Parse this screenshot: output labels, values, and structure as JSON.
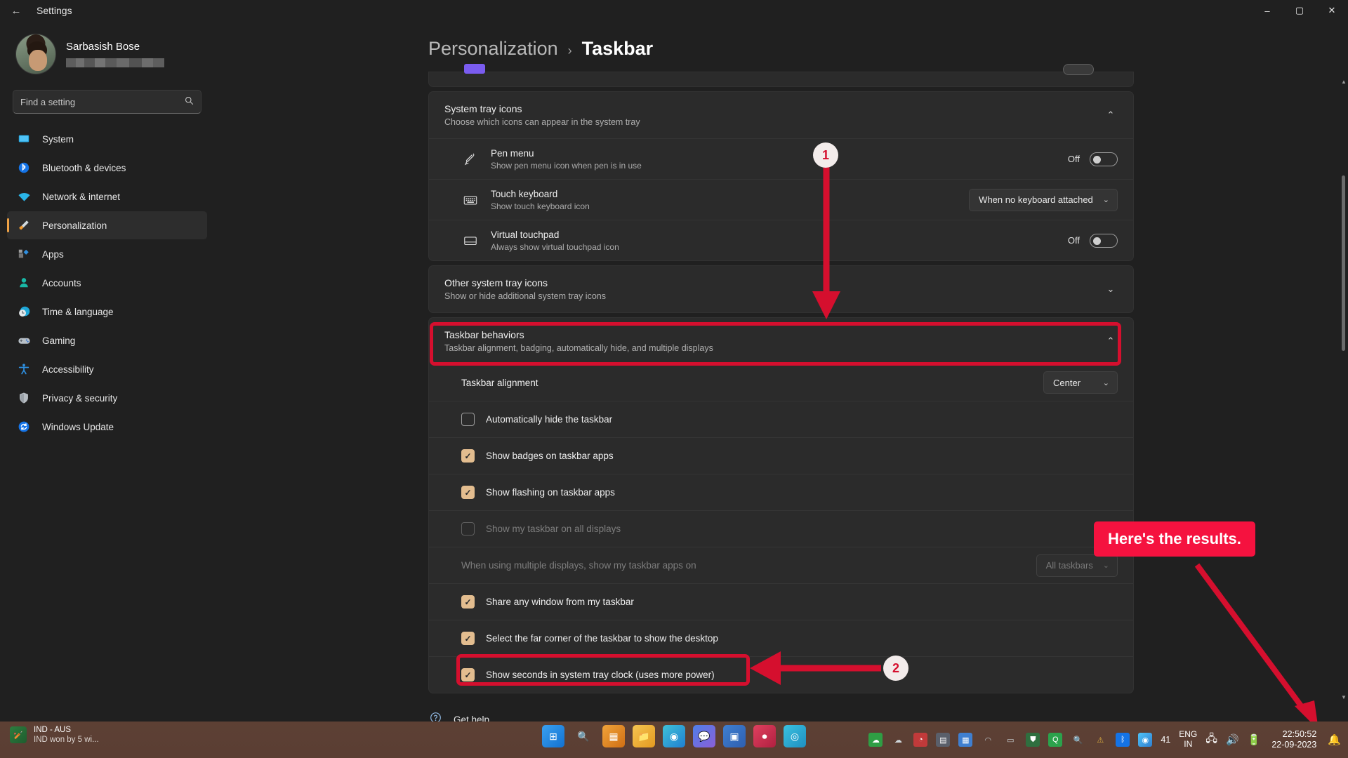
{
  "window": {
    "title": "Settings",
    "back_icon": "arrow-left-icon",
    "minimize": "–",
    "maximize": "▢",
    "close": "✕"
  },
  "sidebar": {
    "profile": {
      "name": "Sarbasish Bose",
      "email_redacted": ""
    },
    "search": {
      "placeholder": "Find a setting",
      "icon": "search-icon"
    },
    "items": [
      {
        "label": "System",
        "icon": "monitor-icon"
      },
      {
        "label": "Bluetooth & devices",
        "icon": "bluetooth-icon"
      },
      {
        "label": "Network & internet",
        "icon": "wifi-icon"
      },
      {
        "label": "Personalization",
        "icon": "brush-icon",
        "active": true
      },
      {
        "label": "Apps",
        "icon": "apps-icon"
      },
      {
        "label": "Accounts",
        "icon": "person-icon"
      },
      {
        "label": "Time & language",
        "icon": "clock-globe-icon"
      },
      {
        "label": "Gaming",
        "icon": "gamepad-icon"
      },
      {
        "label": "Accessibility",
        "icon": "accessibility-icon"
      },
      {
        "label": "Privacy & security",
        "icon": "shield-icon"
      },
      {
        "label": "Windows Update",
        "icon": "update-icon"
      }
    ]
  },
  "breadcrumb": {
    "parent": "Personalization",
    "separator": "›",
    "current": "Taskbar"
  },
  "sections": {
    "system_tray": {
      "title": "System tray icons",
      "subtitle": "Choose which icons can appear in the system tray",
      "chevron": "⌃",
      "rows": [
        {
          "title": "Pen menu",
          "subtitle": "Show pen menu icon when pen is in use",
          "icon": "pen-icon",
          "control": "toggle",
          "state_label": "Off",
          "checked": false
        },
        {
          "title": "Touch keyboard",
          "subtitle": "Show touch keyboard icon",
          "icon": "keyboard-icon",
          "control": "dropdown",
          "value": "When no keyboard attached"
        },
        {
          "title": "Virtual touchpad",
          "subtitle": "Always show virtual touchpad icon",
          "icon": "touchpad-icon",
          "control": "toggle",
          "state_label": "Off",
          "checked": false
        }
      ]
    },
    "other_tray": {
      "title": "Other system tray icons",
      "subtitle": "Show or hide additional system tray icons",
      "chevron": "⌄"
    },
    "taskbar_behaviors": {
      "title": "Taskbar behaviors",
      "subtitle": "Taskbar alignment, badging, automatically hide, and multiple displays",
      "chevron": "⌃",
      "alignment": {
        "label": "Taskbar alignment",
        "value": "Center"
      },
      "checkboxes": [
        {
          "label": "Automatically hide the taskbar",
          "checked": false,
          "disabled": false
        },
        {
          "label": "Show badges on taskbar apps",
          "checked": true,
          "disabled": false
        },
        {
          "label": "Show flashing on taskbar apps",
          "checked": true,
          "disabled": false
        },
        {
          "label": "Show my taskbar on all displays",
          "checked": false,
          "disabled": true
        },
        {
          "label": "Share any window from my taskbar",
          "checked": true,
          "disabled": false
        },
        {
          "label": "Select the far corner of the taskbar to show the desktop",
          "checked": true,
          "disabled": false
        },
        {
          "label": "Show seconds in system tray clock (uses more power)",
          "checked": true,
          "disabled": false
        }
      ],
      "multi_display": {
        "label": "When using multiple displays, show my taskbar apps on",
        "value": "All taskbars"
      }
    },
    "get_help": {
      "label": "Get help",
      "icon": "help-icon"
    }
  },
  "annotations": {
    "badge_one": "1",
    "badge_two": "2",
    "callout": "Here's the results.",
    "accent_color": "#d50f2e",
    "callout_color": "#f5123f"
  },
  "taskbar": {
    "news": {
      "line1": "IND - AUS",
      "line2": "IND won by 5 wi...",
      "icon": "cricket-icon"
    },
    "apps": [
      {
        "name": "start-icon",
        "glyph": "⊞"
      },
      {
        "name": "search-icon",
        "glyph": "🔍"
      },
      {
        "name": "task-view-icon",
        "glyph": "▦"
      },
      {
        "name": "file-explorer-icon",
        "glyph": "📁"
      },
      {
        "name": "edge-icon",
        "glyph": "◉"
      },
      {
        "name": "chat-icon",
        "glyph": "💬"
      },
      {
        "name": "teams-icon",
        "glyph": "▣"
      },
      {
        "name": "record-icon",
        "glyph": "⏺"
      },
      {
        "name": "app-icon",
        "glyph": "◎"
      }
    ],
    "tray": [
      {
        "name": "onedrive-icon",
        "glyph": "☁"
      },
      {
        "name": "cloud-icon",
        "glyph": "☁"
      },
      {
        "name": "app-tray-icon",
        "glyph": "◔"
      },
      {
        "name": "calculator-tray-icon",
        "glyph": "▤"
      },
      {
        "name": "grid-tray-icon",
        "glyph": "▦"
      },
      {
        "name": "cloud2-tray-icon",
        "glyph": "◠"
      },
      {
        "name": "monitor-tray-icon",
        "glyph": "▭"
      },
      {
        "name": "shield-tray-icon",
        "glyph": "⛊"
      },
      {
        "name": "quickbooks-tray-icon",
        "glyph": "Q"
      },
      {
        "name": "search-tray-icon",
        "glyph": "🔍"
      },
      {
        "name": "warning-tray-icon",
        "glyph": "⚠"
      },
      {
        "name": "bluetooth-tray-icon",
        "glyph": "ᛒ"
      },
      {
        "name": "chrome-tray-icon",
        "glyph": "◉"
      }
    ],
    "battery_percent": "41",
    "language": {
      "line1": "ENG",
      "line2": "IN"
    },
    "network_icon": "network-icon",
    "volume_icon": "volume-icon",
    "battery_icon": "battery-icon",
    "clock": {
      "time": "22:50:52",
      "date": "22-09-2023"
    },
    "notification_icon": "notification-bell-icon"
  }
}
